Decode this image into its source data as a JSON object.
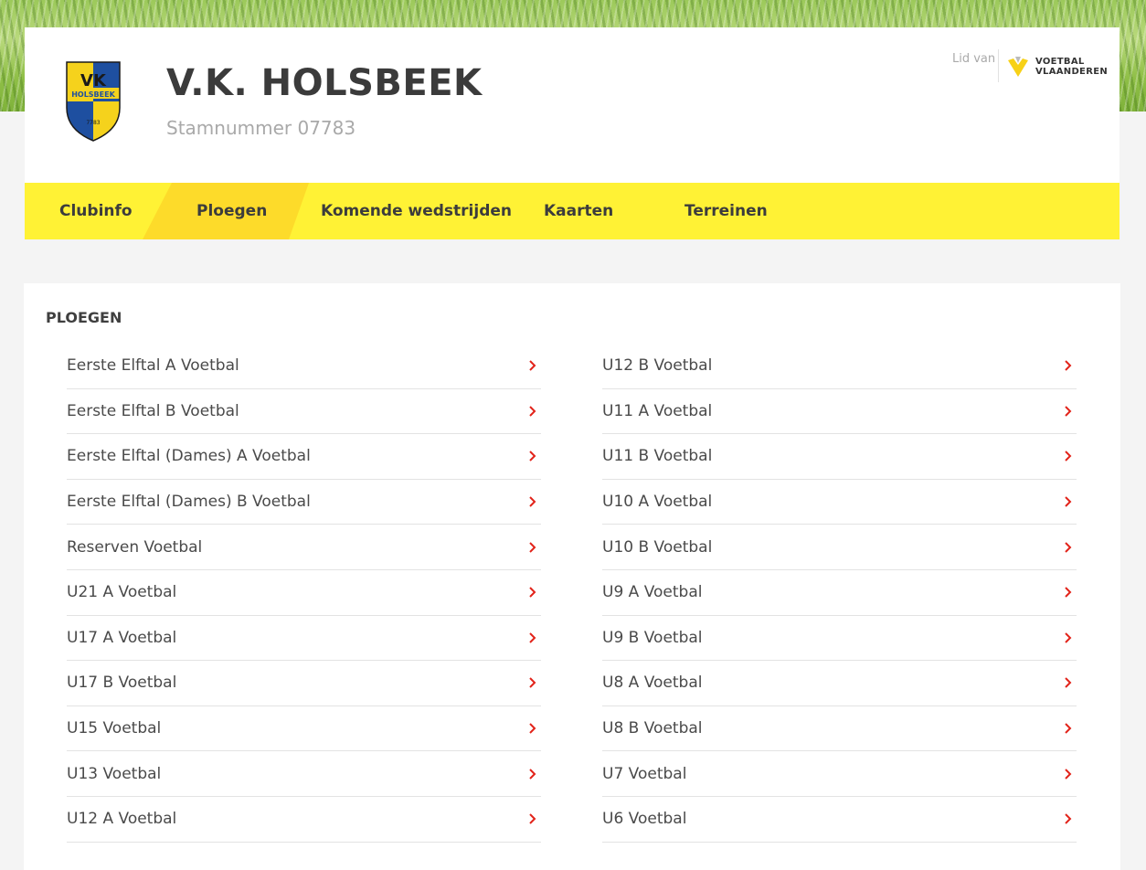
{
  "club": {
    "name": "V.K. HOLSBEEK",
    "stamnummer": "Stamnummer 07783",
    "crest_line1": "VK",
    "crest_line2": "HOLSBEEK",
    "crest_line3": "7783"
  },
  "member": {
    "label": "Lid van",
    "org_line1": "VOETBAL",
    "org_line2": "VLAANDEREN"
  },
  "nav": {
    "items": [
      {
        "label": "Clubinfo"
      },
      {
        "label": "Ploegen",
        "active": true
      },
      {
        "label": "Komende wedstrijden"
      },
      {
        "label": "Kaarten"
      },
      {
        "label": "Terreinen"
      }
    ]
  },
  "section": {
    "title": "PLOEGEN"
  },
  "teams_left": [
    "Eerste Elftal A Voetbal",
    "Eerste Elftal B Voetbal",
    "Eerste Elftal (Dames) A Voetbal",
    "Eerste Elftal (Dames) B Voetbal",
    "Reserven Voetbal",
    "U21 A Voetbal",
    "U17 A Voetbal",
    "U17 B Voetbal",
    "U15 Voetbal",
    "U13 Voetbal",
    "U12 A Voetbal"
  ],
  "teams_right": [
    "U12 B Voetbal",
    "U11 A Voetbal",
    "U11 B Voetbal",
    "U10 A Voetbal",
    "U10 B Voetbal",
    "U9 A Voetbal",
    "U9 B Voetbal",
    "U8 A Voetbal",
    "U8 B Voetbal",
    "U7 Voetbal",
    "U6 Voetbal"
  ],
  "colors": {
    "nav_bg": "#fff235",
    "nav_active": "#fddb2a",
    "chevron": "#e2231a"
  }
}
